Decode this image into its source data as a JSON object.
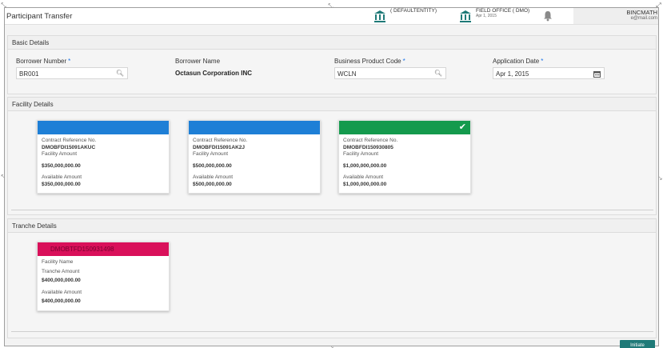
{
  "header": {
    "title": "Participant Transfer",
    "entity1": {
      "name": "( DEFAULTENTITY)"
    },
    "entity2": {
      "name": "FIELD OFFICE ( DMO)",
      "date": "Apr 1, 2015"
    },
    "user": {
      "name": "BINCMATH",
      "email": "e@mail.com"
    }
  },
  "basic": {
    "heading": "Basic Details",
    "borrower_number": {
      "label": "Borrower Number",
      "value": "BR001"
    },
    "borrower_name": {
      "label": "Borrower Name",
      "value": "Octasun Corporation INC"
    },
    "product_code": {
      "label": "Business Product Code",
      "value": "WCLN"
    },
    "application_date": {
      "label": "Application Date",
      "value": "Apr 1, 2015"
    },
    "required_mark": "*"
  },
  "facility": {
    "heading": "Facility Details",
    "cards": [
      {
        "ref_label": "Contract Reference No.",
        "ref": "DMOBFDI15091AKUC",
        "amount_label": "Facility Amount",
        "amount": "$350,000,000.00",
        "avail_label": "Available Amount",
        "avail": "$350,000,000.00",
        "color": "#1e7fd6",
        "selected": false
      },
      {
        "ref_label": "Contract Reference No.",
        "ref": "DMOBFDI15091AK2J",
        "amount_label": "Facility Amount",
        "amount": "$500,000,000.00",
        "avail_label": "Available Amount",
        "avail": "$500,000,000.00",
        "color": "#1e7fd6",
        "selected": false
      },
      {
        "ref_label": "Contract Reference No.",
        "ref": "DMOBFDI150930805",
        "amount_label": "Facility Amount",
        "amount": "$1,000,000,000.00",
        "avail_label": "Available Amount",
        "avail": "$1,000,000,000.00",
        "color": "#149a4d",
        "selected": true,
        "check": "✔"
      }
    ]
  },
  "tranche": {
    "heading": "Tranche Details",
    "card": {
      "band_text": "DMOBTFD150931498",
      "name_label": "Facility Name",
      "amount_label": "Tranche Amount",
      "amount": "$400,000,000.00",
      "avail_label": "Available Amount",
      "avail": "$400,000,000.00",
      "color": "#d9105a"
    }
  },
  "actions": {
    "initiate": "Initiate"
  },
  "icons": {
    "search": "search-icon",
    "calendar": "calendar-icon",
    "bank": "bank-icon",
    "bell": "bell-icon",
    "check": "check-icon"
  }
}
